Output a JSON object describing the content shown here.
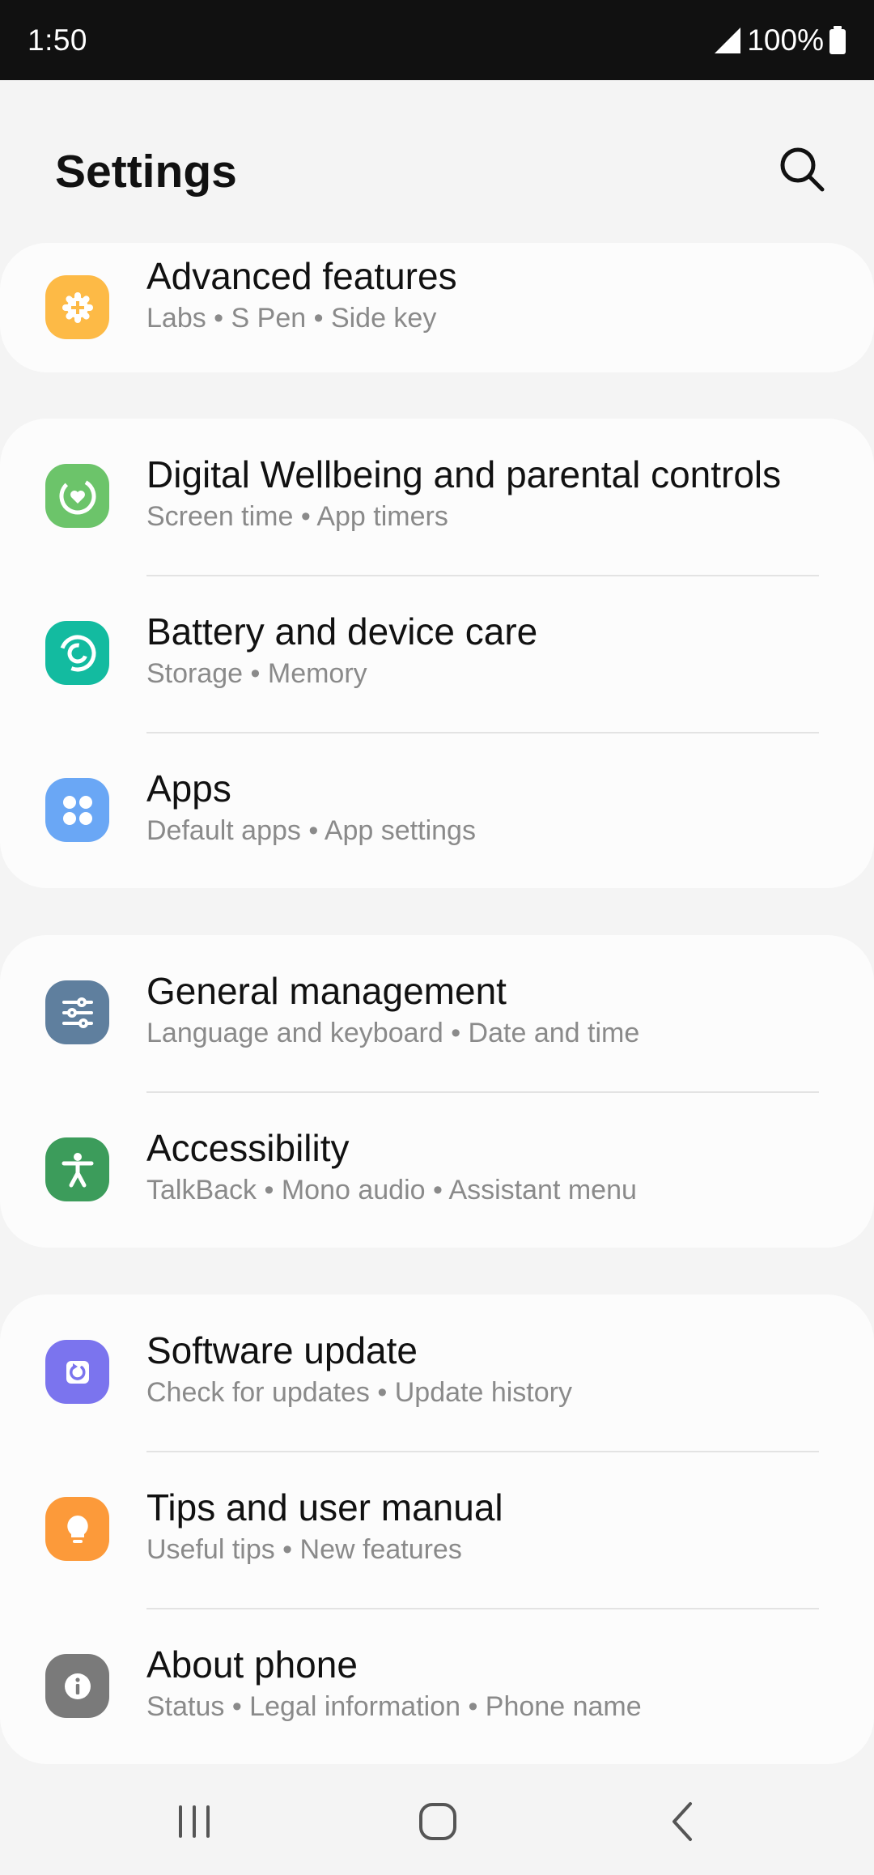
{
  "status_bar": {
    "time": "1:50",
    "battery": "100%",
    "icons": [
      "signal-icon",
      "battery-icon"
    ]
  },
  "header": {
    "title": "Settings",
    "search_icon": "search-icon"
  },
  "groups": [
    {
      "items": [
        {
          "title": "Advanced features",
          "subtitle": "Labs  •  S Pen  •  Side key",
          "icon": "advanced-features-icon",
          "color": "#FDBA46"
        }
      ]
    },
    {
      "items": [
        {
          "title": "Digital Wellbeing and parental controls",
          "subtitle": "Screen time  •  App timers",
          "icon": "digital-wellbeing-icon",
          "color": "#6CC46A"
        },
        {
          "title": "Battery and device care",
          "subtitle": "Storage  •  Memory",
          "icon": "device-care-icon",
          "color": "#13BBA0"
        },
        {
          "title": "Apps",
          "subtitle": "Default apps  •  App settings",
          "icon": "apps-icon",
          "color": "#6AA7F5"
        }
      ]
    },
    {
      "items": [
        {
          "title": "General management",
          "subtitle": "Language and keyboard  •  Date and time",
          "icon": "general-management-icon",
          "color": "#5F7F9E"
        },
        {
          "title": "Accessibility",
          "subtitle": "TalkBack  •  Mono audio  •  Assistant menu",
          "icon": "accessibility-icon",
          "color": "#3C9C5B"
        }
      ]
    },
    {
      "items": [
        {
          "title": "Software update",
          "subtitle": "Check for updates  •  Update history",
          "icon": "software-update-icon",
          "color": "#7B74EE"
        },
        {
          "title": "Tips and user manual",
          "subtitle": "Useful tips  •  New features",
          "icon": "tips-icon",
          "color": "#FC9A3A"
        },
        {
          "title": "About phone",
          "subtitle": "Status  •  Legal information  •  Phone name",
          "icon": "info-icon",
          "color": "#7A7A7A"
        }
      ]
    }
  ],
  "nav_bar": {
    "icons": [
      "recent-apps-icon",
      "home-icon",
      "back-icon"
    ]
  }
}
